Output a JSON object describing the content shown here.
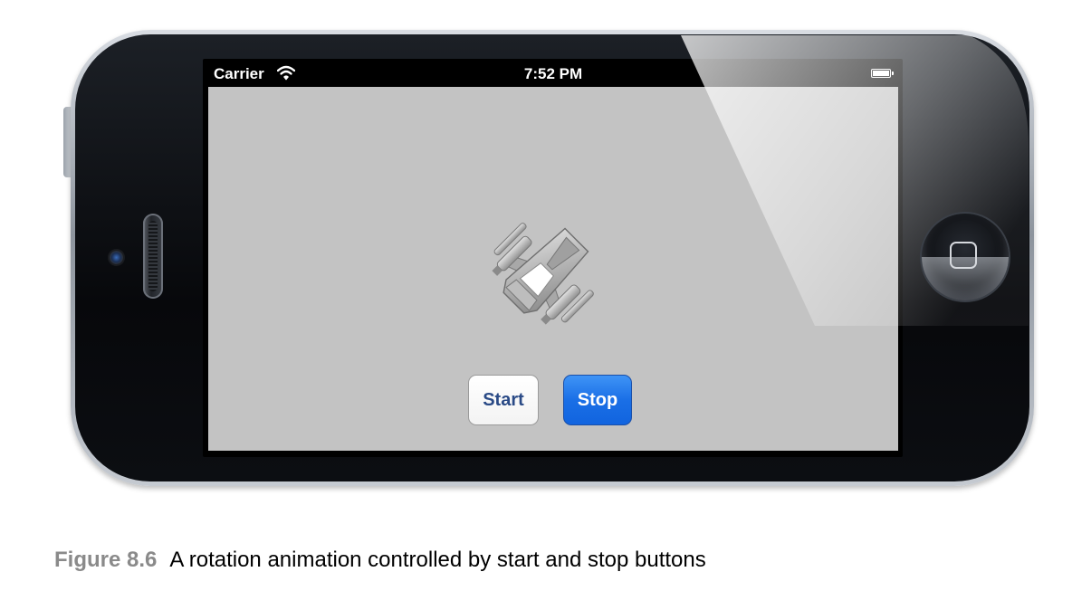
{
  "status_bar": {
    "carrier": "Carrier",
    "time": "7:52 PM",
    "icons": [
      "wifi-icon",
      "battery-icon"
    ]
  },
  "app": {
    "image": "spaceship-icon",
    "buttons": {
      "start_label": "Start",
      "stop_label": "Stop"
    }
  },
  "device": {
    "home_button_icon": "home-square-icon"
  },
  "caption": {
    "label": "Figure 8.6",
    "text": "A rotation animation controlled by start and stop buttons"
  },
  "colors": {
    "screen_background": "#c3c3c3",
    "stop_button": "#1a6fe6",
    "start_text": "#2a4a86",
    "caption_label": "#8a8a8a"
  }
}
